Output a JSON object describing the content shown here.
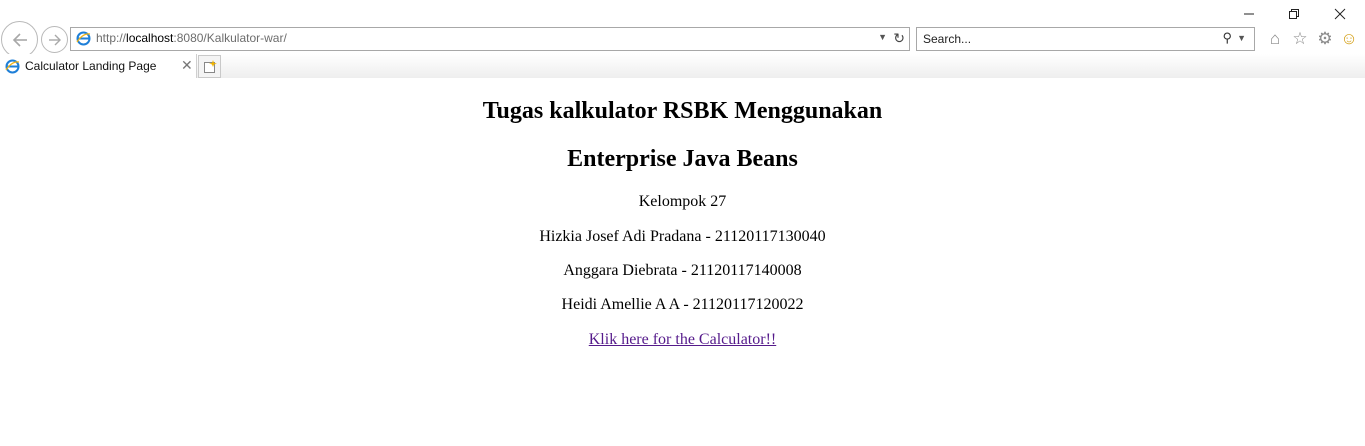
{
  "browser": {
    "address_protocol": "http://",
    "address_host": "localhost",
    "address_rest": ":8080/Kalkulator-war/",
    "search_placeholder": "Search...",
    "tab_title": "Calculator Landing Page"
  },
  "content": {
    "heading_line1": "Tugas kalkulator RSBK Menggunakan",
    "heading_line2": "Enterprise Java Beans",
    "group": "Kelompok 27",
    "member1": "Hizkia Josef Adi Pradana - 21120117130040",
    "member2": "Anggara Diebrata - 21120117140008",
    "member3": "Heidi Amellie A A - 21120117120022",
    "link_text": "Klik here for the Calculator!!"
  }
}
